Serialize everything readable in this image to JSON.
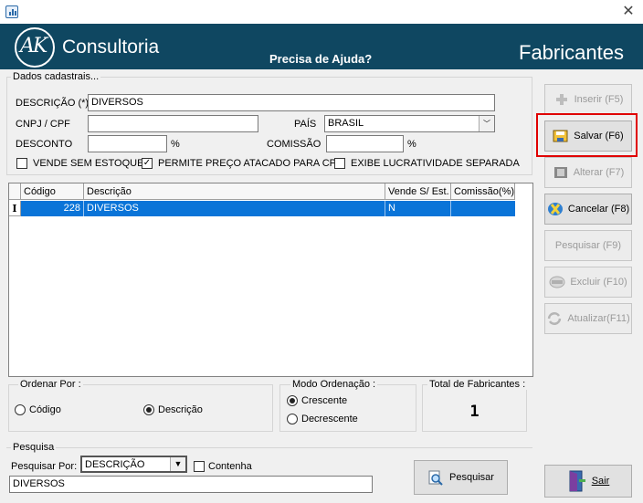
{
  "window": {
    "close_glyph": "✕"
  },
  "banner": {
    "logo_text": "AK",
    "brand": "Consultoria",
    "help": "Precisa de Ajuda?",
    "title": "Fabricantes"
  },
  "form": {
    "group_label": "Dados cadastrais...",
    "descricao_label": "DESCRIÇÃO (*)",
    "descricao_value": "DIVERSOS",
    "cnpj_label": "CNPJ / CPF",
    "cnpj_value": "",
    "pais_label": "PAÍS",
    "pais_value": "BRASIL",
    "desconto_label": "DESCONTO",
    "desconto_value": "",
    "percent": "%",
    "comissao_label": "COMISSÃO",
    "comissao_value": "",
    "chk_vende_label": "VENDE SEM ESTOQUE",
    "chk_vende_checked": false,
    "chk_permite_label": "PERMITE PREÇO ATACADO PARA CPF",
    "chk_permite_checked": true,
    "chk_exibe_label": "EXIBE LUCRATIVIDADE SEPARADA",
    "chk_exibe_checked": false,
    "checkmark": "✓"
  },
  "grid": {
    "columns": [
      "Código",
      "Descrição",
      "Vende S/ Est.",
      "Comissão(%)"
    ],
    "rows": [
      {
        "indicator": "I",
        "codigo": "228",
        "descricao": "DIVERSOS",
        "vende": "N",
        "comissao": ""
      }
    ]
  },
  "ordenar": {
    "label": "Ordenar Por :",
    "opt_codigo": "Código",
    "opt_descricao": "Descrição",
    "selected": "Descrição"
  },
  "modo": {
    "label": "Modo Ordenação :",
    "opt_crescente": "Crescente",
    "opt_decrescente": "Decrescente",
    "selected": "Crescente"
  },
  "total": {
    "label": "Total de Fabricantes :",
    "value": "1"
  },
  "pesquisa": {
    "group_label": "Pesquisa",
    "por_label": "Pesquisar Por:",
    "por_value": "DESCRIÇÃO",
    "contenha_label": "Contenha",
    "contenha_checked": false,
    "query_value": "DIVERSOS",
    "button_label": "Pesquisar"
  },
  "actions": {
    "inserir": "Inserir (F5)",
    "salvar": "Salvar (F6)",
    "alterar": "Alterar (F7)",
    "cancelar": "Cancelar (F8)",
    "pesquisar": "Pesquisar (F9)",
    "excluir": "Excluir (F10)",
    "atualizar": "Atualizar(F11)",
    "sair": "Sair"
  },
  "colors": {
    "banner": "#0f4761",
    "selection": "#0a74d8",
    "highlight_border": "#e00000"
  }
}
